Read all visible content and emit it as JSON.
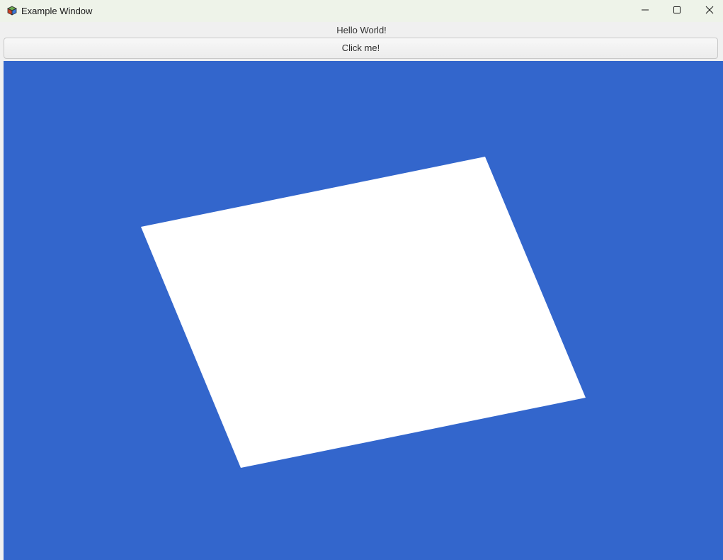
{
  "window": {
    "title": "Example Window"
  },
  "main": {
    "label_text": "Hello World!",
    "button_label": "Click me!"
  },
  "canvas": {
    "background_color": "#3366cc",
    "shape_color": "#ffffff"
  },
  "icons": {
    "app": "cube-icon",
    "minimize": "minimize-icon",
    "maximize": "maximize-icon",
    "close": "close-icon"
  }
}
